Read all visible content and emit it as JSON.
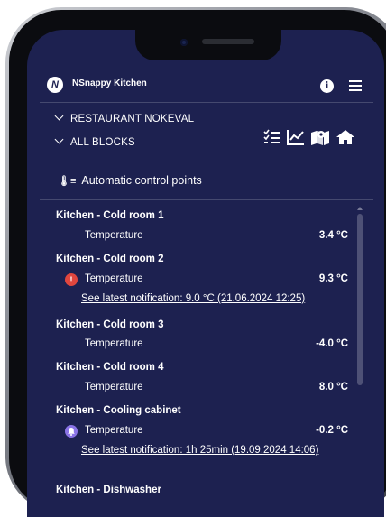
{
  "app": {
    "logo_letter": "N",
    "title": "NSnappy Kitchen",
    "info_icon": "info-icon",
    "menu_icon": "hamburger-menu-icon"
  },
  "filters": {
    "restaurant": "RESTAURANT NOKEVAL",
    "blocks": "ALL BLOCKS"
  },
  "toolbar_icons": [
    "checklist-icon",
    "chart-icon",
    "map-icon",
    "home-icon"
  ],
  "section": {
    "icon": "control-points-icon",
    "title": "Automatic control points"
  },
  "groups": [
    {
      "title": "Kitchen - Cold room 1",
      "label": "Temperature",
      "value": "3.4 °C"
    },
    {
      "title": "Kitchen - Cold room 2",
      "label": "Temperature",
      "value": "9.3 °C",
      "alert": "!",
      "alert_color": "#e0463e",
      "notification": "See latest notification: 9.0 °C (21.06.2024 12:25)"
    },
    {
      "title": "Kitchen - Cold room 3",
      "label": "Temperature",
      "value": "-4.0 °C"
    },
    {
      "title": "Kitchen - Cold room 4",
      "label": "Temperature",
      "value": "8.0 °C"
    },
    {
      "title": "Kitchen - Cooling cabinet",
      "label": "Temperature",
      "value": "-0.2 °C",
      "alert": "bell",
      "alert_color": "#8b74e6",
      "notification": "See latest notification: 1h 25min (19.09.2024 14:06)"
    },
    {
      "title": "Kitchen - Dishwasher"
    }
  ],
  "colors": {
    "screen_bg": "#1d2150",
    "alert_red": "#e0463e",
    "alert_purple": "#8b74e6"
  }
}
